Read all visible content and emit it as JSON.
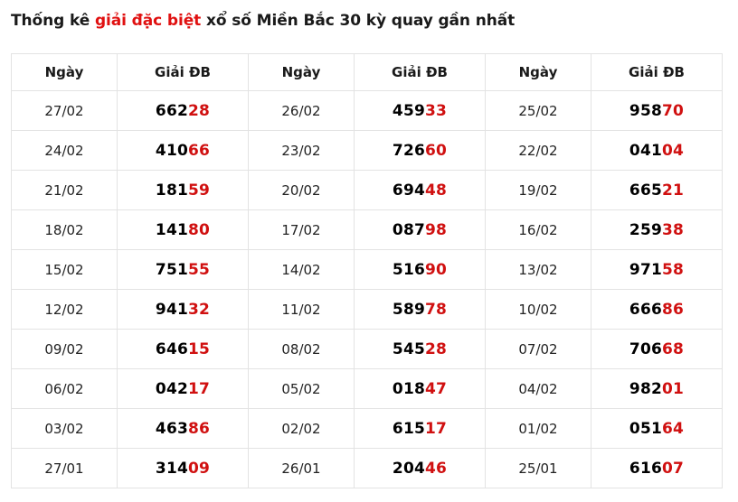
{
  "title": {
    "before": "Thống kê ",
    "highlight": "giải đặc biệt",
    "after": " xổ số Miền Bắc 30 kỳ quay gần nhất"
  },
  "colors": {
    "highlight": "#e01010",
    "tail": "#d01010",
    "border": "#e3e3e3"
  },
  "headers": {
    "date": "Ngày",
    "prize": "Giải ĐB"
  },
  "rows": [
    [
      {
        "date": "27/02",
        "head": "662",
        "tail": "28"
      },
      {
        "date": "26/02",
        "head": "459",
        "tail": "33"
      },
      {
        "date": "25/02",
        "head": "958",
        "tail": "70"
      }
    ],
    [
      {
        "date": "24/02",
        "head": "410",
        "tail": "66"
      },
      {
        "date": "23/02",
        "head": "726",
        "tail": "60"
      },
      {
        "date": "22/02",
        "head": "041",
        "tail": "04"
      }
    ],
    [
      {
        "date": "21/02",
        "head": "181",
        "tail": "59"
      },
      {
        "date": "20/02",
        "head": "694",
        "tail": "48"
      },
      {
        "date": "19/02",
        "head": "665",
        "tail": "21"
      }
    ],
    [
      {
        "date": "18/02",
        "head": "141",
        "tail": "80"
      },
      {
        "date": "17/02",
        "head": "087",
        "tail": "98"
      },
      {
        "date": "16/02",
        "head": "259",
        "tail": "38"
      }
    ],
    [
      {
        "date": "15/02",
        "head": "751",
        "tail": "55"
      },
      {
        "date": "14/02",
        "head": "516",
        "tail": "90"
      },
      {
        "date": "13/02",
        "head": "971",
        "tail": "58"
      }
    ],
    [
      {
        "date": "12/02",
        "head": "941",
        "tail": "32"
      },
      {
        "date": "11/02",
        "head": "589",
        "tail": "78"
      },
      {
        "date": "10/02",
        "head": "666",
        "tail": "86"
      }
    ],
    [
      {
        "date": "09/02",
        "head": "646",
        "tail": "15"
      },
      {
        "date": "08/02",
        "head": "545",
        "tail": "28"
      },
      {
        "date": "07/02",
        "head": "706",
        "tail": "68"
      }
    ],
    [
      {
        "date": "06/02",
        "head": "042",
        "tail": "17"
      },
      {
        "date": "05/02",
        "head": "018",
        "tail": "47"
      },
      {
        "date": "04/02",
        "head": "982",
        "tail": "01"
      }
    ],
    [
      {
        "date": "03/02",
        "head": "463",
        "tail": "86"
      },
      {
        "date": "02/02",
        "head": "615",
        "tail": "17"
      },
      {
        "date": "01/02",
        "head": "051",
        "tail": "64"
      }
    ],
    [
      {
        "date": "27/01",
        "head": "314",
        "tail": "09"
      },
      {
        "date": "26/01",
        "head": "204",
        "tail": "46"
      },
      {
        "date": "25/01",
        "head": "616",
        "tail": "07"
      }
    ]
  ]
}
